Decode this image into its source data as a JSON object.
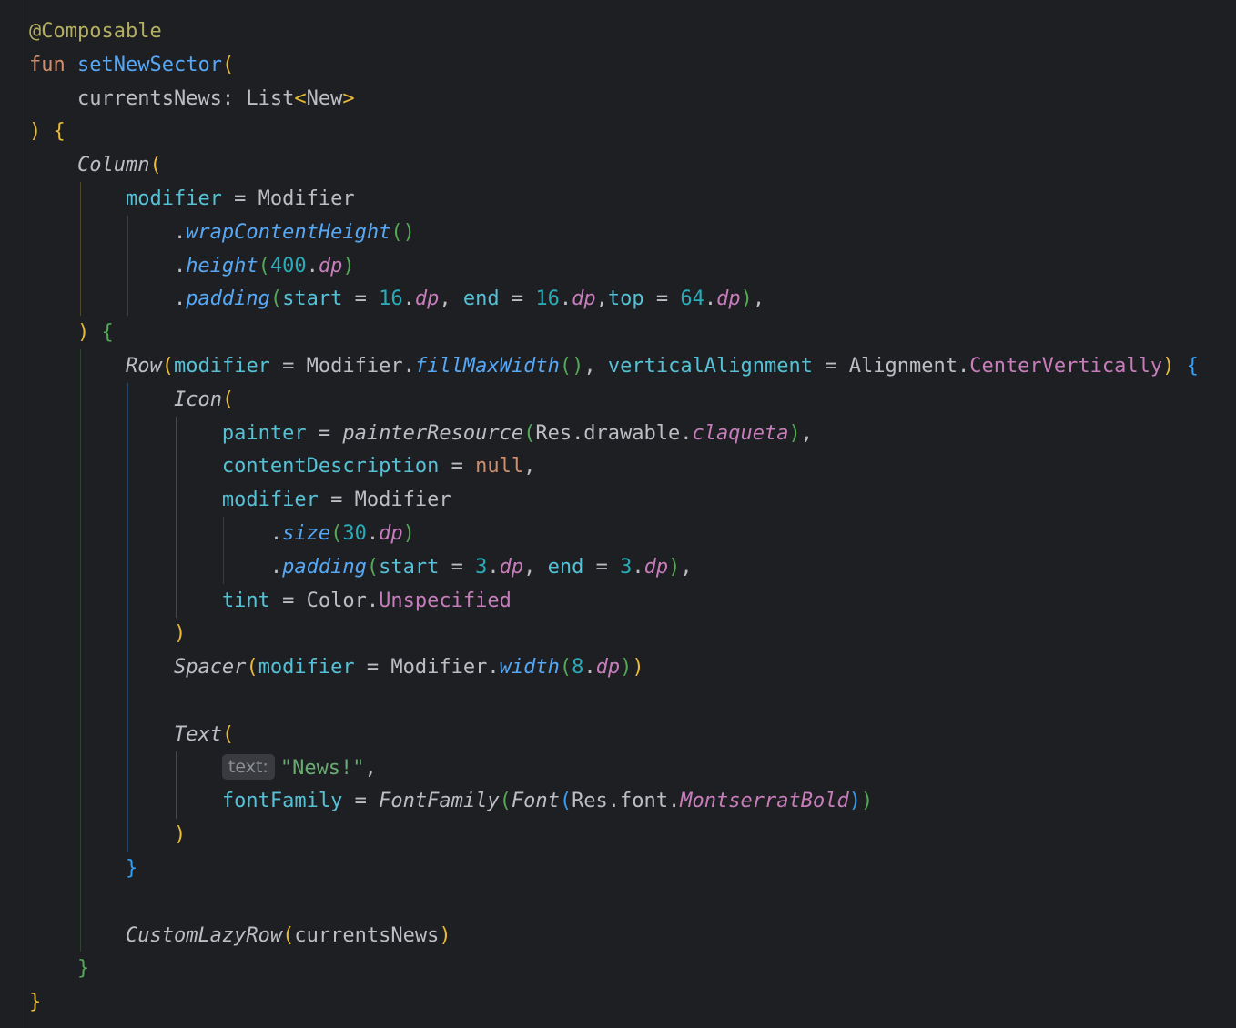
{
  "editor": {
    "language": "kotlin",
    "theme_colors": {
      "background": "#1e1f22",
      "default_text": "#bcbec4",
      "keyword": "#cf8e6d",
      "annotation": "#b3ae60",
      "function_declaration": "#56a8f5",
      "named_argument": "#56c1d6",
      "number": "#2aacb8",
      "property": "#c77dbb",
      "string": "#6aab73",
      "bracket_level_1": "#e8ba36",
      "bracket_level_2": "#54a857",
      "bracket_level_3": "#359ff4"
    },
    "lines": [
      [
        [
          "ann",
          "@Composable"
        ]
      ],
      [
        [
          "kw",
          "fun"
        ],
        [
          "text",
          " "
        ],
        [
          "fn",
          "setNewSector"
        ],
        [
          "b1",
          "("
        ]
      ],
      [
        [
          "text",
          "    currentsNews: List"
        ],
        [
          "b1",
          "<"
        ],
        [
          "text",
          "New"
        ],
        [
          "b1",
          ">"
        ]
      ],
      [
        [
          "b1",
          ")"
        ],
        [
          "text",
          " "
        ],
        [
          "b1",
          "{"
        ]
      ],
      [
        [
          "text",
          "    "
        ],
        [
          "comp",
          "Column"
        ],
        [
          "b1",
          "("
        ]
      ],
      [
        [
          "text",
          "        "
        ],
        [
          "param",
          "modifier"
        ],
        [
          "text",
          " = Modifier"
        ]
      ],
      [
        [
          "text",
          "            ."
        ],
        [
          "ext",
          "wrapContentHeight"
        ],
        [
          "b2",
          "()"
        ]
      ],
      [
        [
          "text",
          "            ."
        ],
        [
          "ext",
          "height"
        ],
        [
          "b2",
          "("
        ],
        [
          "num",
          "400"
        ],
        [
          "text",
          "."
        ],
        [
          "prop",
          "dp"
        ],
        [
          "b2",
          ")"
        ]
      ],
      [
        [
          "text",
          "            ."
        ],
        [
          "ext",
          "padding"
        ],
        [
          "b2",
          "("
        ],
        [
          "param",
          "start"
        ],
        [
          "text",
          " = "
        ],
        [
          "num",
          "16"
        ],
        [
          "text",
          "."
        ],
        [
          "prop",
          "dp"
        ],
        [
          "text",
          ", "
        ],
        [
          "param",
          "end"
        ],
        [
          "text",
          " = "
        ],
        [
          "num",
          "16"
        ],
        [
          "text",
          "."
        ],
        [
          "prop",
          "dp"
        ],
        [
          "text",
          ","
        ],
        [
          "param",
          "top"
        ],
        [
          "text",
          " = "
        ],
        [
          "num",
          "64"
        ],
        [
          "text",
          "."
        ],
        [
          "prop",
          "dp"
        ],
        [
          "b2",
          ")"
        ],
        [
          "text",
          ","
        ]
      ],
      [
        [
          "text",
          "    "
        ],
        [
          "b1",
          ")"
        ],
        [
          "text",
          " "
        ],
        [
          "b2",
          "{"
        ]
      ],
      [
        [
          "text",
          "        "
        ],
        [
          "comp",
          "Row"
        ],
        [
          "b1",
          "("
        ],
        [
          "param",
          "modifier"
        ],
        [
          "text",
          " = Modifier."
        ],
        [
          "ext",
          "fillMaxWidth"
        ],
        [
          "b2",
          "()"
        ],
        [
          "text",
          ", "
        ],
        [
          "param",
          "verticalAlignment"
        ],
        [
          "text",
          " = Alignment."
        ],
        [
          "const",
          "CenterVertically"
        ],
        [
          "b1",
          ")"
        ],
        [
          "text",
          " "
        ],
        [
          "b3",
          "{"
        ]
      ],
      [
        [
          "text",
          "            "
        ],
        [
          "comp",
          "Icon"
        ],
        [
          "b1",
          "("
        ]
      ],
      [
        [
          "text",
          "                "
        ],
        [
          "param",
          "painter"
        ],
        [
          "text",
          " = "
        ],
        [
          "comp",
          "painterResource"
        ],
        [
          "b2",
          "("
        ],
        [
          "text",
          "Res.drawable."
        ],
        [
          "prop",
          "claqueta"
        ],
        [
          "b2",
          ")"
        ],
        [
          "text",
          ","
        ]
      ],
      [
        [
          "text",
          "                "
        ],
        [
          "param",
          "contentDescription"
        ],
        [
          "text",
          " = "
        ],
        [
          "kw",
          "null"
        ],
        [
          "text",
          ","
        ]
      ],
      [
        [
          "text",
          "                "
        ],
        [
          "param",
          "modifier"
        ],
        [
          "text",
          " = Modifier"
        ]
      ],
      [
        [
          "text",
          "                    ."
        ],
        [
          "ext",
          "size"
        ],
        [
          "b2",
          "("
        ],
        [
          "num",
          "30"
        ],
        [
          "text",
          "."
        ],
        [
          "prop",
          "dp"
        ],
        [
          "b2",
          ")"
        ]
      ],
      [
        [
          "text",
          "                    ."
        ],
        [
          "ext",
          "padding"
        ],
        [
          "b2",
          "("
        ],
        [
          "param",
          "start"
        ],
        [
          "text",
          " = "
        ],
        [
          "num",
          "3"
        ],
        [
          "text",
          "."
        ],
        [
          "prop",
          "dp"
        ],
        [
          "text",
          ", "
        ],
        [
          "param",
          "end"
        ],
        [
          "text",
          " = "
        ],
        [
          "num",
          "3"
        ],
        [
          "text",
          "."
        ],
        [
          "prop",
          "dp"
        ],
        [
          "b2",
          ")"
        ],
        [
          "text",
          ","
        ]
      ],
      [
        [
          "text",
          "                "
        ],
        [
          "param",
          "tint"
        ],
        [
          "text",
          " = Color."
        ],
        [
          "const",
          "Unspecified"
        ]
      ],
      [
        [
          "text",
          "            "
        ],
        [
          "b1",
          ")"
        ]
      ],
      [
        [
          "text",
          "            "
        ],
        [
          "comp",
          "Spacer"
        ],
        [
          "b1",
          "("
        ],
        [
          "param",
          "modifier"
        ],
        [
          "text",
          " = Modifier."
        ],
        [
          "ext",
          "width"
        ],
        [
          "b2",
          "("
        ],
        [
          "num",
          "8"
        ],
        [
          "text",
          "."
        ],
        [
          "prop",
          "dp"
        ],
        [
          "b2",
          ")"
        ],
        [
          "b1",
          ")"
        ]
      ],
      [],
      [
        [
          "text",
          "            "
        ],
        [
          "comp",
          "Text"
        ],
        [
          "b1",
          "("
        ]
      ],
      [
        [
          "text",
          "                "
        ],
        [
          "hint",
          "text:"
        ],
        [
          "str",
          "\"News!\""
        ],
        [
          "text",
          ","
        ]
      ],
      [
        [
          "text",
          "                "
        ],
        [
          "param",
          "fontFamily"
        ],
        [
          "text",
          " = "
        ],
        [
          "comp",
          "FontFamily"
        ],
        [
          "b2",
          "("
        ],
        [
          "comp",
          "Font"
        ],
        [
          "b3",
          "("
        ],
        [
          "text",
          "Res.font."
        ],
        [
          "prop",
          "MontserratBold"
        ],
        [
          "b3",
          ")"
        ],
        [
          "b2",
          ")"
        ]
      ],
      [
        [
          "text",
          "            "
        ],
        [
          "b1",
          ")"
        ]
      ],
      [
        [
          "text",
          "        "
        ],
        [
          "b3",
          "}"
        ]
      ],
      [],
      [
        [
          "text",
          "        "
        ],
        [
          "comp",
          "CustomLazyRow"
        ],
        [
          "b1",
          "("
        ],
        [
          "text",
          "currentsNews"
        ],
        [
          "b1",
          ")"
        ]
      ],
      [
        [
          "text",
          "    "
        ],
        [
          "b2",
          "}"
        ]
      ],
      [
        [
          "b1",
          "}"
        ]
      ]
    ]
  }
}
